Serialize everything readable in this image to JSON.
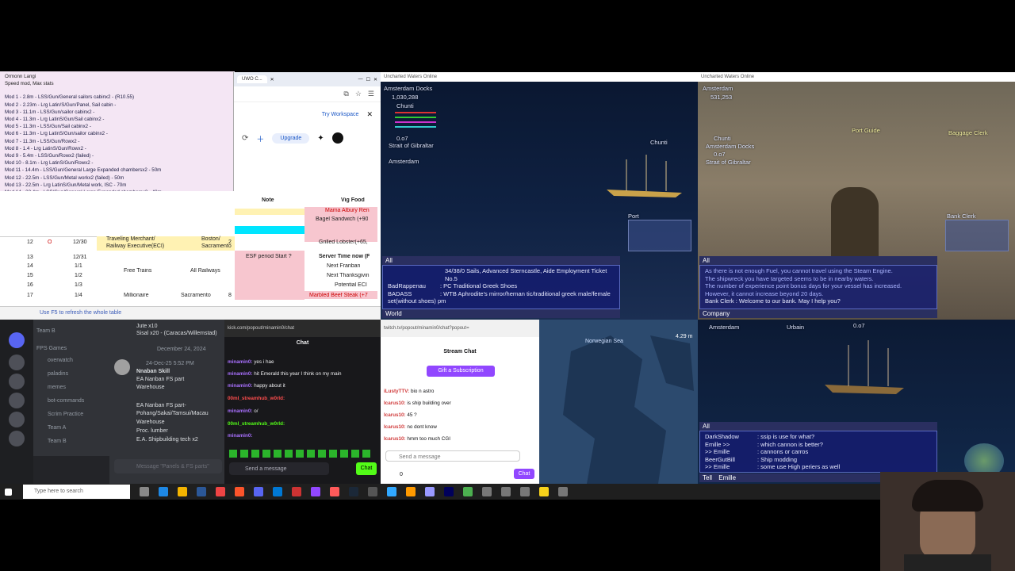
{
  "notes": {
    "title": "Ormonn Langi",
    "subtitle": "Speed mod, Max stats",
    "lines": [
      "Mod 1 - 2.8m - LSS/Gun/General sailors cabinx2 - (R10.55)",
      "Mod 2 - 2.23m - Lrg Latin/S/Gun/Panel, Sail cabin -",
      "Mod 3 - 11.1m - LSS/Gun/sailor cabinx2 -",
      "Mod 4 - 11.3m - Lrg LatinS/Gun/Sail cabinx2 -",
      "Mod 5 - 11.3m - LSS/Gun/Sail cabinx2 -",
      "Mod 6 - 11.3m - Lrg LatinS/Gun/sailor cabinx2 -",
      "Mod 7 - 11.3m - LSS/Gun/Rowx2 -",
      "Mod 8 - 1.4 - Lrg LatinS/Gun/Rowx2 -",
      "Mod 9 - 5.4m - LSS/Gun/Rowx2 (failed) -",
      "Mod 10 - 8.1m - Lrg LatinS/Gun/Rowx2 -",
      "Mod 11 - 14.4m - LSS/Gun/General Large Expanded chambersx2 - 50m",
      "Mod 12 - 22.5m - LSS/Gun/Metal workx2 (failed) - 50m",
      "Mod 13 - 22.5m - Lrg LatinS/Gun/Metal work, ISC - 70m",
      "Mod 14 - 32.4m - LSS/Gun/General Large Expanded chambersx2 - 40m",
      "Mod 15 - 44.1m - LSquareS/Gun/Metal work, ISC - 70m"
    ]
  },
  "browser": {
    "tab_title": "UWO C...",
    "try_workspace": "Try Workspace",
    "upgrade": "Upgrade"
  },
  "sheet": {
    "col_headers": [
      "Note",
      "Vig Food"
    ],
    "food_items": [
      "Mama Albury Ren",
      "Bagel Sandwich (+90",
      "Grilled Lobster(+65,"
    ],
    "rows": [
      {
        "num": "12",
        "mark": "O",
        "date": "12/30",
        "who": "Traveling Merchant/ Railway Executive(ECI)",
        "where": "Boston/ Sacramento",
        "n": "2"
      },
      {
        "num": "13",
        "mark": "",
        "date": "12/31",
        "who": "",
        "where": "",
        "n": ""
      },
      {
        "num": "14",
        "mark": "",
        "date": "1/1",
        "who": "Free Trains",
        "where": "All Railways",
        "n": ""
      },
      {
        "num": "15",
        "mark": "",
        "date": "1/2",
        "who": "",
        "where": "",
        "n": ""
      },
      {
        "num": "16",
        "mark": "",
        "date": "1/3",
        "who": "",
        "where": "",
        "n": ""
      },
      {
        "num": "17",
        "mark": "",
        "date": "1/4",
        "who": "Millionaire",
        "where": "Sacramento",
        "n": "8"
      }
    ],
    "side_notes": [
      "ESF period Start ?",
      "Server Time now (F",
      "Next Franban",
      "Next Thanksgivin",
      "Potential ECI",
      "Marbled Beef Steak (+7"
    ],
    "footer": "Use F5 to refresh the whole table"
  },
  "game1": {
    "title": "Uncharted Waters Online",
    "location": "Amsterdam Docks",
    "money": "1,030,288",
    "player": "Chunti",
    "status": "0.o7",
    "area": "Strait of Gibraltar",
    "port": "Amsterdam",
    "ship_name": "Chunti",
    "port_label": "Port",
    "chat_tab": "All",
    "chat_lines": [
      {
        "who": "",
        "text": "34/38/0 Sails, Advanced Sterncastle, Aide Employment Ticket No.5"
      },
      {
        "who": "BadRappenau",
        "text": ": PC Traditional Greek Shoes"
      },
      {
        "who": "BADASS",
        "text": ": WTB Aphrodite's mirror/hernan tic/traditional greek male/female set(without shoes) pm"
      }
    ],
    "world_tab": "World"
  },
  "game2": {
    "title": "Uncharted Waters Online",
    "location": "Amsterdam",
    "money": "531,253",
    "player": "Chunti",
    "sublocation": "Amsterdam Docks",
    "status": "0.o7",
    "area": "Strait of Gibraltar",
    "npc1": "Port Guide",
    "npc2": "Baggage Clerk",
    "bank_label": "Bank Clerk",
    "chat_tab": "All",
    "chat_lines": [
      "As there is not enough Fuel, you cannot travel using the Steam Engine.",
      "The shipwreck you have targeted seems to be in nearby waters.",
      "The number of experience point bonus days for your vessel has increased.",
      "However, it cannot increase beyond 20 days.",
      "Bank Clerk : Welcome to our bank. May I help you?"
    ],
    "company_tab": "Company"
  },
  "game3": {
    "location": "Amsterdam",
    "player": "Urbain",
    "status": "0.o7",
    "chat_tab": "All",
    "chat_lines": [
      {
        "who": "DarkShadow",
        "text": ": ssip is use for what?"
      },
      {
        "who": "Emille >>",
        "text": ": which cannon is better?"
      },
      {
        "who": ">> Emille",
        "text": ": cannons or carros"
      },
      {
        "who": "BeerGutBill",
        "text": ": Ship modding"
      },
      {
        "who": ">> Emille",
        "text": ": some use High periers as well"
      }
    ],
    "tell_tab": "Tell",
    "tell_target": "Emille"
  },
  "discord": {
    "server_items": [
      "Team B",
      "FPS Games",
      "overwatch",
      "paladins",
      "memes",
      "bot-commands",
      "Scrim Practice",
      "Team A",
      "Team B"
    ],
    "msg_top": "Jute x10",
    "msg_top2": "Sisal x20 - (Caracas/Willemstad)",
    "date_divider": "December 24, 2024",
    "time": "24-Dec-25 5:52 PM",
    "post_lines": [
      "Nnaban Skill",
      "EA Nanban FS part",
      "Warehouse",
      "",
      "EA Nanban FS part-",
      "Pohang/Sakai/Tamsui/Macau",
      "Warehouse",
      "Proc. lumber",
      "E.A. Shipbuilding tech x2"
    ],
    "placeholder": "Message \"Panels & FS parts\""
  },
  "chat1": {
    "url": "kick.com/popout/minamin0/chat",
    "title": "Chat",
    "lines": [
      {
        "who": "minamin0:",
        "text": "yes i hae"
      },
      {
        "who": "minamin0:",
        "text": "hit Emerald this year I think on my main"
      },
      {
        "who": "minamin0:",
        "text": "happy about it"
      },
      {
        "who": "00ml_streamhub_w0rld:",
        "text": ""
      },
      {
        "who": "minamin0:",
        "text": "o/"
      },
      {
        "who": "00ml_streamhub_w0rld:",
        "text": ""
      },
      {
        "who": "minamin0:",
        "text": ""
      }
    ],
    "placeholder": "Send a message",
    "send": "Chat"
  },
  "chat2": {
    "url": "twitch.tv/popout/minamin0/chat?popout=",
    "title": "Stream Chat",
    "gift": "Gift a Subscription",
    "lines": [
      {
        "who": "iLustyTTV:",
        "text": "bio n astro"
      },
      {
        "who": "Icarus10:",
        "text": "is ship building over"
      },
      {
        "who": "Icarus10:",
        "text": "45 ?"
      },
      {
        "who": "Icarus10:",
        "text": "no dont know"
      },
      {
        "who": "Icarus10:",
        "text": "hmm too much CGI"
      }
    ],
    "placeholder": "Send a message",
    "count": "0",
    "send": "Chat"
  },
  "map": {
    "title": "Norwegian Sea",
    "zoom_label": "4.29 m"
  },
  "taskbar": {
    "search_placeholder": "Type here to search"
  },
  "colors": {
    "twitch_purple": "#9147ff",
    "kick_green": "#53fc18",
    "sheet_pink": "#f7c6cf",
    "sheet_cyan": "#00e5ff",
    "sheet_yellow": "#fff2b3",
    "notes_bg": "#f4e6f4"
  }
}
